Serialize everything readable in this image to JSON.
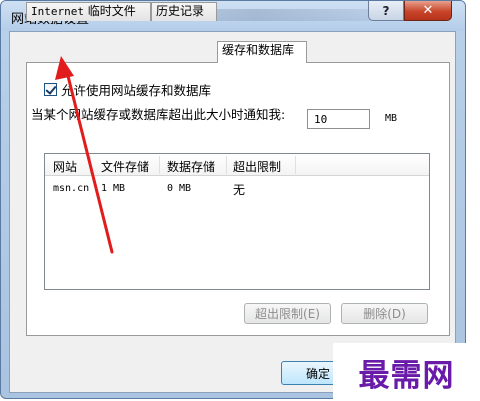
{
  "window": {
    "title": "网站数据设置",
    "help_icon": "question-mark-icon",
    "help_label": "?",
    "close_icon": "close-x-icon",
    "close_label": "✕"
  },
  "tabs": [
    {
      "label_latin": "Internet",
      "label_cjk": " 临时文件",
      "active": false
    },
    {
      "label": "历史记录",
      "active": false
    },
    {
      "label": "缓存和数据库",
      "active": true
    }
  ],
  "cache_page": {
    "allow_checkbox_label": "允许使用网站缓存和数据库",
    "allow_checked": true,
    "quota_label": "当某个网站缓存或数据库超出此大小时通知我:",
    "quota_value": "10",
    "quota_unit": "MB",
    "list": {
      "columns": [
        "网站",
        "文件存储",
        "数据存储",
        "超出限制"
      ],
      "rows": [
        {
          "site": "msn.cn",
          "file_storage": "1 MB",
          "data_storage": "0 MB",
          "exceeded": "无"
        }
      ]
    },
    "exceed_limit_button": "超出限制(E)",
    "delete_button": "删除(D)"
  },
  "footer": {
    "ok_button": "确定"
  },
  "watermark": {
    "text": "最需网"
  },
  "annotation": {
    "arrow_color": "#e11c1c"
  }
}
